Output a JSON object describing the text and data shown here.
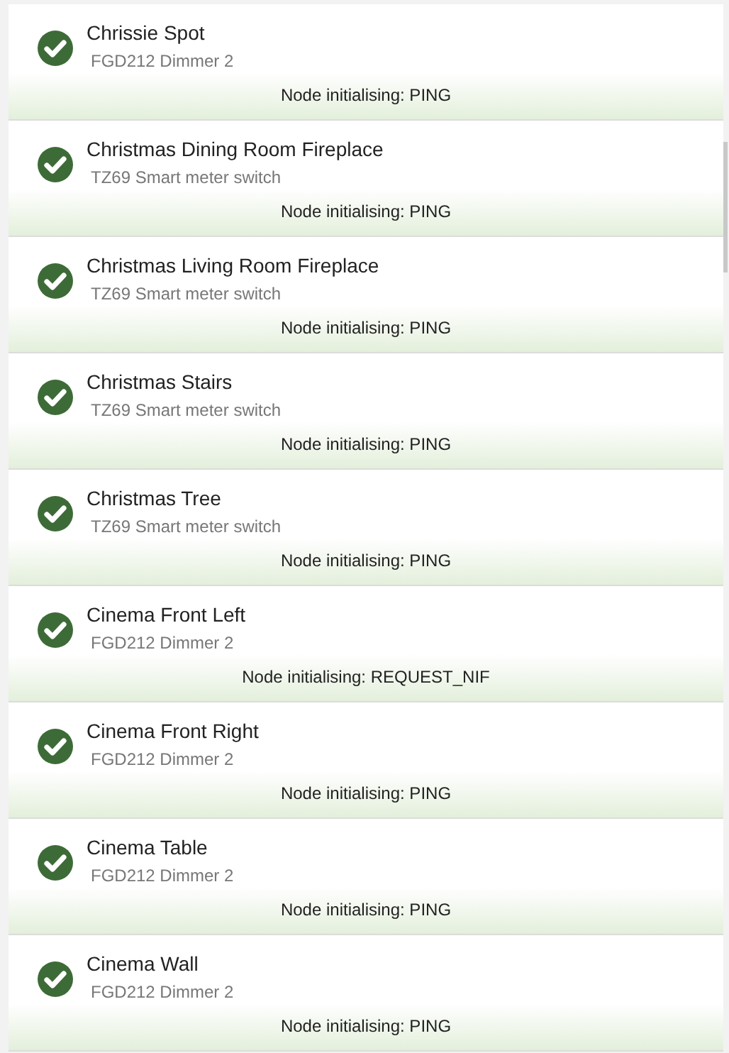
{
  "devices": [
    {
      "name": "Chrissie Spot",
      "model": "FGD212 Dimmer 2",
      "status": "Node initialising: PING"
    },
    {
      "name": "Christmas Dining Room Fireplace",
      "model": "TZ69 Smart meter switch",
      "status": "Node initialising: PING"
    },
    {
      "name": "Christmas Living Room Fireplace",
      "model": "TZ69 Smart meter switch",
      "status": "Node initialising: PING"
    },
    {
      "name": "Christmas Stairs",
      "model": "TZ69 Smart meter switch",
      "status": "Node initialising: PING"
    },
    {
      "name": "Christmas Tree",
      "model": "TZ69 Smart meter switch",
      "status": "Node initialising: PING"
    },
    {
      "name": "Cinema Front Left",
      "model": "FGD212 Dimmer 2",
      "status": "Node initialising: REQUEST_NIF"
    },
    {
      "name": "Cinema Front Right",
      "model": "FGD212 Dimmer 2",
      "status": "Node initialising: PING"
    },
    {
      "name": "Cinema Table",
      "model": "FGD212 Dimmer 2",
      "status": "Node initialising: PING"
    },
    {
      "name": "Cinema Wall",
      "model": "FGD212 Dimmer 2",
      "status": "Node initialising: PING"
    }
  ]
}
